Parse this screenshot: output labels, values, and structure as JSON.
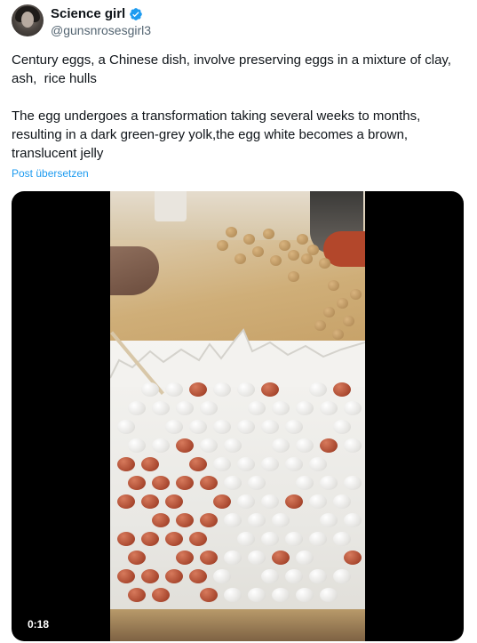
{
  "author": {
    "display_name": "Science girl",
    "handle": "@gunsnrosesgirl3",
    "verified": true,
    "verified_color": "#1d9bf0",
    "avatar_icon": "avatar-icon"
  },
  "tweet": {
    "text": "Century eggs, a Chinese dish, involve preserving eggs in a mixture of clay, ash,  rice hulls\n\nThe egg undergoes a transformation taking several weeks to months, resulting in a dark green-grey yolk,the egg white becomes a brown, translucent jelly",
    "translate_label": "Post übersetzen",
    "link_color": "#1d9bf0"
  },
  "media": {
    "type": "video",
    "duration": "0:18",
    "description_icon": "video-thumbnail"
  }
}
